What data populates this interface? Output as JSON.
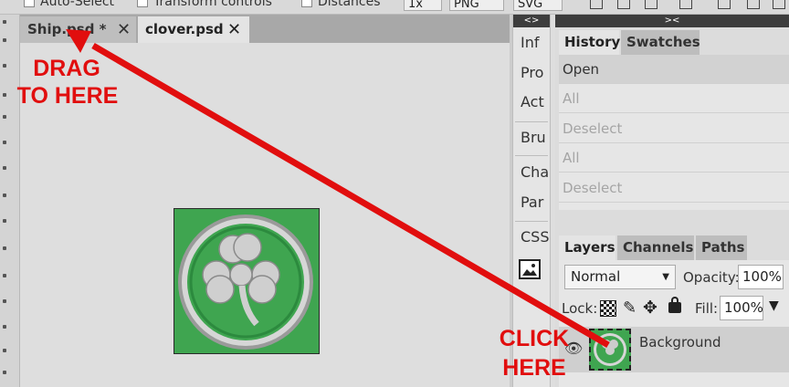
{
  "topbar": {
    "auto_select": "Auto-Select",
    "transform_controls": "Transform controls",
    "distances": "Distances",
    "scale": "1x",
    "png": "PNG",
    "svg": "SVG"
  },
  "doc_tabs": [
    {
      "label": "Ship.psd *",
      "close": "✕"
    },
    {
      "label": "clover.psd",
      "close": "✕"
    }
  ],
  "mini_panel": {
    "collapse": "<>",
    "items": [
      "Inf",
      "Pro",
      "Act",
      "Bru",
      "Cha",
      "Par",
      "CSS"
    ]
  },
  "history_panel": {
    "collapse": "><",
    "tabs": [
      "History",
      "Swatches"
    ],
    "items": [
      "Open",
      "All",
      "Deselect",
      "All",
      "Deselect"
    ]
  },
  "layers_panel": {
    "tabs": [
      "Layers",
      "Channels",
      "Paths"
    ],
    "blend_mode": "Normal",
    "opacity_label": "Opacity:",
    "opacity_value": "100%",
    "lock_label": "Lock:",
    "fill_label": "Fill:",
    "fill_value": "100%",
    "layer_name": "Background"
  },
  "annotations": {
    "drag_line1": "DRAG",
    "drag_line2": "TO HERE",
    "click_line1": "CLICK",
    "click_line2": "HERE"
  },
  "colors": {
    "annotation_red": "#e10e0e",
    "clover_green": "#3fa550",
    "panel_header": "#3d3d3d"
  }
}
